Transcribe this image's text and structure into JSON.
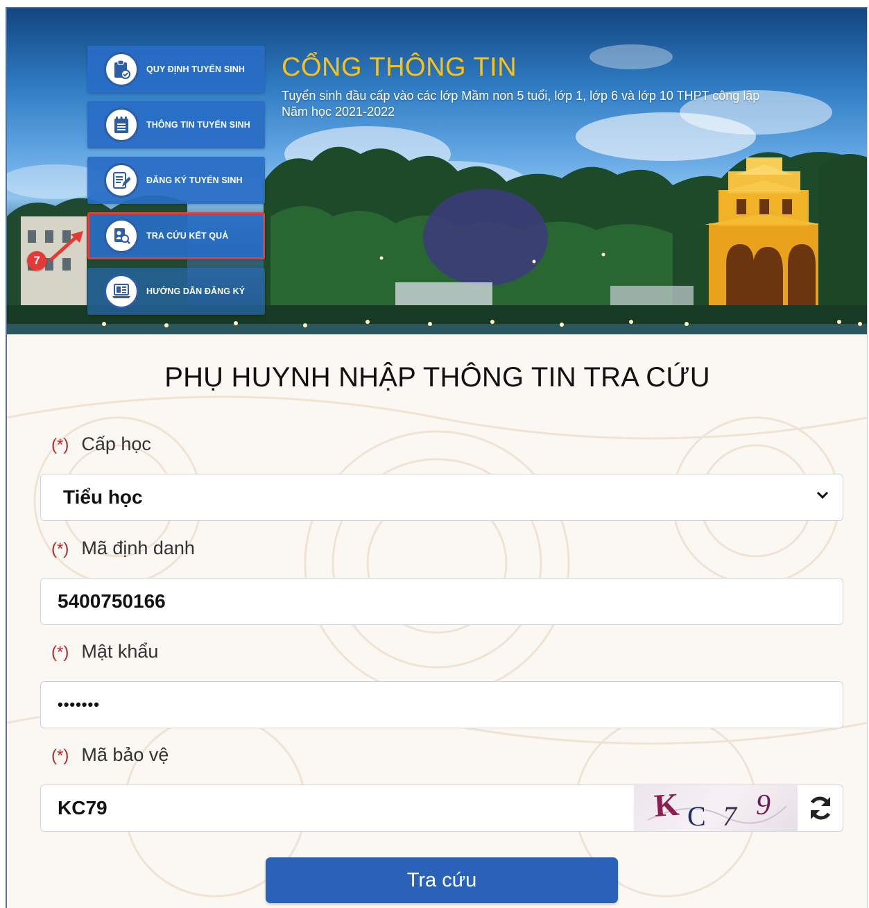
{
  "header": {
    "title": "CỔNG THÔNG TIN",
    "subtitle_line1": "Tuyển sinh đầu cấp vào các lớp Mầm non 5 tuổi, lớp 1, lớp 6 và lớp 10 THPT công lập",
    "subtitle_line2": "Năm học 2021-2022"
  },
  "menu": {
    "items": [
      {
        "label": "QUY ĐỊNH TUYỂN SINH",
        "icon": "clipboard-check-icon"
      },
      {
        "label": "THÔNG TIN TUYỂN SINH",
        "icon": "notepad-icon"
      },
      {
        "label": "ĐĂNG KÝ TUYỂN SINH",
        "icon": "document-edit-icon"
      },
      {
        "label": "TRA CỨU KẾT QUẢ",
        "icon": "search-document-icon"
      },
      {
        "label": "HƯỚNG DẪN ĐĂNG KÝ",
        "icon": "laptop-guide-icon"
      }
    ],
    "active_index": 3
  },
  "step_badge": "7",
  "form": {
    "title": "PHỤ HUYNH NHẬP THÔNG TIN TRA CỨU",
    "required_mark": "(*)",
    "level_label": "Cấp học",
    "level_value": "Tiểu học",
    "id_label": "Mã định danh",
    "id_value": "5400750166",
    "password_label": "Mật khẩu",
    "password_value": "•••••••",
    "captcha_label": "Mã bảo vệ",
    "captcha_value": "KC79",
    "captcha_chars": [
      "K",
      "C",
      "7",
      "9"
    ],
    "submit_label": "Tra cứu"
  },
  "colors": {
    "accent": "#2a62b9",
    "title_gold": "#f7c21b",
    "required": "#c0282c",
    "highlight": "#e2403c"
  }
}
